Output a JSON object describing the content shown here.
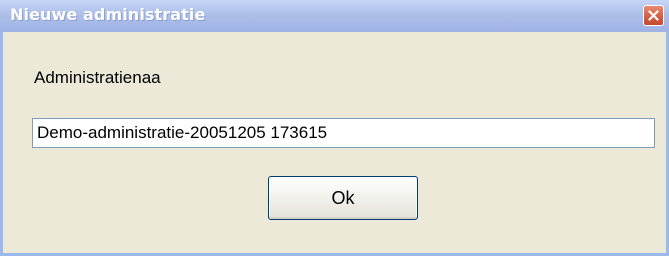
{
  "window": {
    "title": "Nieuwe administratie"
  },
  "form": {
    "label": "Administratienaa",
    "name_value": "Demo-administratie-20051205 173615"
  },
  "buttons": {
    "ok_label": "Ok"
  },
  "icons": {
    "close": "close-icon"
  },
  "colors": {
    "titlebar": "#aebfe9",
    "dialog_bg": "#ece9d8",
    "close_button": "#d35f44",
    "input_border": "#7f9db9"
  }
}
